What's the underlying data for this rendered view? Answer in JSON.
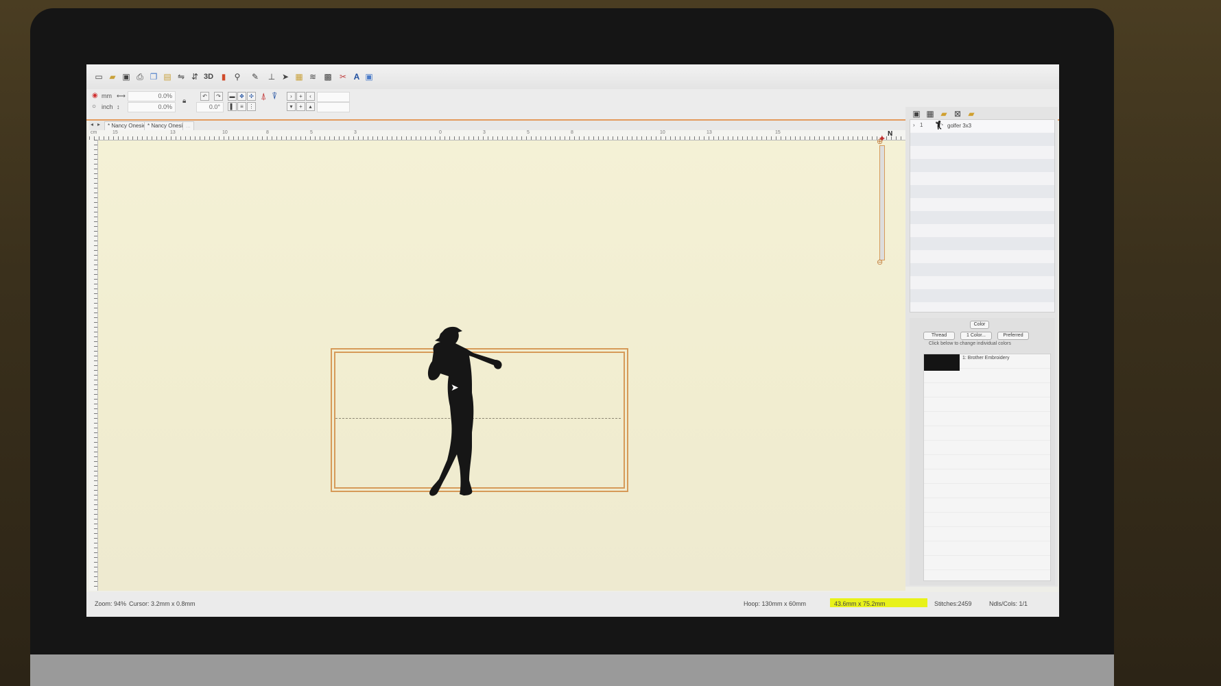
{
  "toolbar": {
    "icons": [
      "new-icon",
      "open-icon",
      "save-icon",
      "print-icon",
      "copy-icon",
      "paste-icon",
      "flip-horizontal-icon",
      "flip-vertical-icon",
      "3d-view-icon",
      "chart-icon",
      "zoom-icon",
      "measure-icon",
      "stitch-icon",
      "select-icon",
      "hoop-icon",
      "align-icon",
      "grid-icon",
      "wizard-icon",
      "text-icon",
      "lettering-icon"
    ],
    "btn_3d": "3D",
    "btn_text": "A"
  },
  "options": {
    "unit_mm": "mm",
    "unit_inch": "inch",
    "width_pct": "0.0%",
    "height_pct": "0.0%",
    "rotation": "0.0°"
  },
  "tabs": [
    "* Nancy Onesie",
    "* Nancy Onesi...",
    "..."
  ],
  "ruler": {
    "unit": "cm",
    "h_labels": [
      "15",
      "13",
      "10",
      "8",
      "5",
      "3",
      "0",
      "3",
      "5",
      "8",
      "10",
      "13",
      "15"
    ]
  },
  "compass_label": "N",
  "objects": [
    {
      "index": "1",
      "name": "golfer 3x3"
    }
  ],
  "color_panel": {
    "title": "Color",
    "tabs": [
      "Thread",
      "1 Color...",
      "Preferred"
    ],
    "hint": "Click below to change individual colors",
    "colors": [
      {
        "label": "1: Brother Embroidery",
        "hex": "#141414"
      }
    ]
  },
  "status": {
    "zoom": "Zoom: 94%",
    "cursor": "Cursor: 3.2mm x 0.8mm",
    "hoop": "Hoop: 130mm x  60mm",
    "design_size": "43.6mm x 75.2mm",
    "stitches": "Stitches:2459",
    "ndls": "Ndls/Cols: 1/1"
  },
  "colors": {
    "accent": "#e39a5c",
    "hoop": "#d69a58",
    "canvas": "#f3f0d3",
    "highlight": "#e8f21a"
  }
}
